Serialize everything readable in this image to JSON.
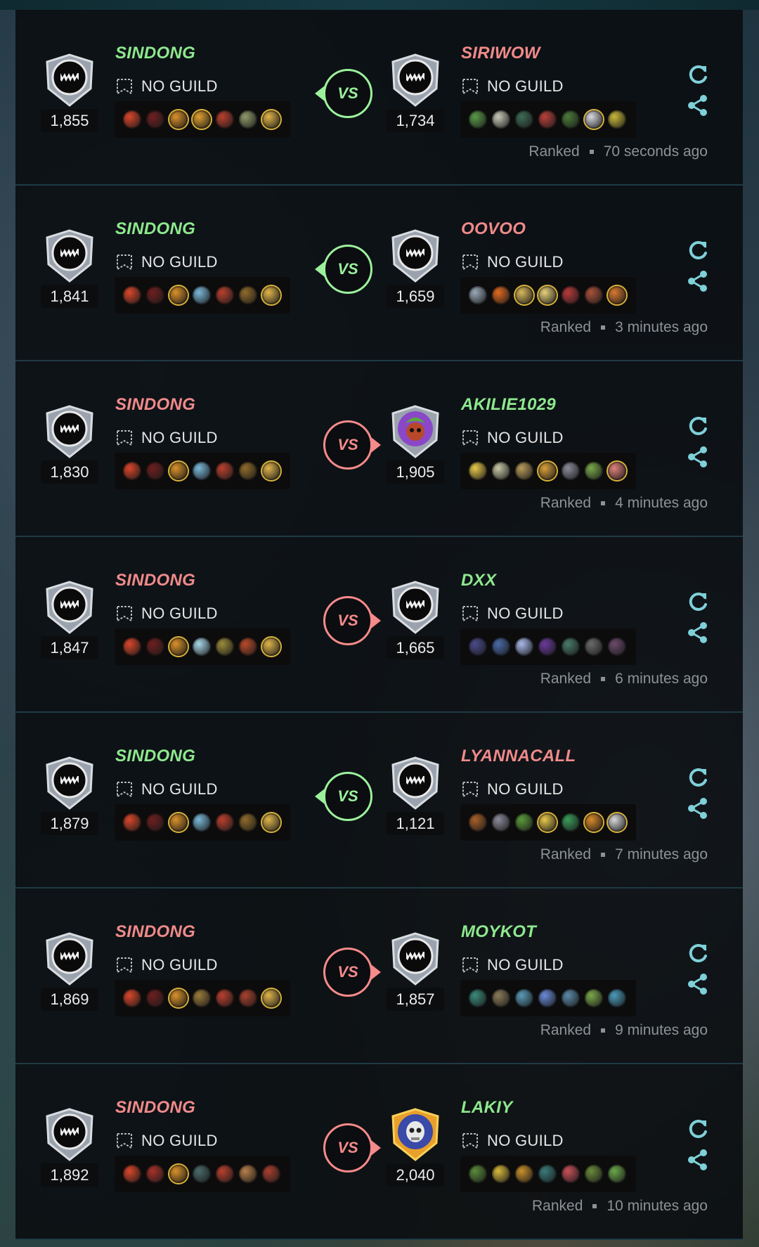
{
  "colors": {
    "win": "#8ee88e",
    "lose": "#f08a8a",
    "accent": "#7fd0d8"
  },
  "matches": [
    {
      "vs_label": "VS",
      "vs_result": "win",
      "left": {
        "name": "SINDONG",
        "result": "win",
        "guild": "NO GUILD",
        "rating": "1,855",
        "badge": "monster-badge-icon",
        "units": [
          "#d8462a",
          "#6e1f1f",
          "#d9912a",
          "#e0a030",
          "#b8402e",
          "#8f9a6a",
          "#e0b44a"
        ]
      },
      "right": {
        "name": "SIRIWOW",
        "result": "lose",
        "guild": "NO GUILD",
        "rating": "1,734",
        "badge": "monster-badge-icon",
        "units": [
          "#5a9a4a",
          "#c8c8b8",
          "#3d6a55",
          "#b8403a",
          "#4a7a3a",
          "#d8d8e0",
          "#c8b83a"
        ]
      },
      "mode": "Ranked",
      "time": "70 seconds ago"
    },
    {
      "vs_label": "VS",
      "vs_result": "win",
      "left": {
        "name": "SINDONG",
        "result": "win",
        "guild": "NO GUILD",
        "rating": "1,841",
        "badge": "monster-badge-icon",
        "units": [
          "#d8462a",
          "#6e1f1f",
          "#d9912a",
          "#7ab8d8",
          "#b8402e",
          "#8f6a2a",
          "#e0b44a"
        ]
      },
      "right": {
        "name": "OOVOO",
        "result": "lose",
        "guild": "NO GUILD",
        "rating": "1,659",
        "badge": "monster-badge-icon",
        "units": [
          "#9aa8b8",
          "#e06a20",
          "#d8b85a",
          "#e8d07a",
          "#b83a3a",
          "#a8503a",
          "#d87a30"
        ]
      },
      "mode": "Ranked",
      "time": "3 minutes ago"
    },
    {
      "vs_label": "VS",
      "vs_result": "lose",
      "left": {
        "name": "SINDONG",
        "result": "lose",
        "guild": "NO GUILD",
        "rating": "1,830",
        "badge": "monster-badge-icon",
        "units": [
          "#d8462a",
          "#6e1f1f",
          "#d9912a",
          "#7ab8d8",
          "#b8402e",
          "#8f6a2a",
          "#e0b44a"
        ]
      },
      "right": {
        "name": "AKILIE1029",
        "result": "win",
        "guild": "NO GUILD",
        "rating": "1,905",
        "badge": "avatar-badge-icon",
        "units": [
          "#e8c84a",
          "#c8c8a8",
          "#b89a5a",
          "#d8a03a",
          "#8a8a9a",
          "#7aa84a",
          "#e0807a"
        ]
      },
      "mode": "Ranked",
      "time": "4 minutes ago"
    },
    {
      "vs_label": "VS",
      "vs_result": "lose",
      "left": {
        "name": "SINDONG",
        "result": "lose",
        "guild": "NO GUILD",
        "rating": "1,847",
        "badge": "monster-badge-icon",
        "units": [
          "#d8462a",
          "#6e1f1f",
          "#d9912a",
          "#a8d8e8",
          "#9a8a3a",
          "#b84a2a",
          "#e0b44a"
        ]
      },
      "right": {
        "name": "DXX",
        "result": "win",
        "guild": "NO GUILD",
        "rating": "1,665",
        "badge": "monster-badge-icon",
        "units": [
          "#4a4a8a",
          "#4a6aa8",
          "#a8b8e8",
          "#6a3a9a",
          "#4a7a6a",
          "#6a6a6a",
          "#6a4a6a"
        ]
      },
      "mode": "Ranked",
      "time": "6 minutes ago"
    },
    {
      "vs_label": "VS",
      "vs_result": "win",
      "left": {
        "name": "SINDONG",
        "result": "win",
        "guild": "NO GUILD",
        "rating": "1,879",
        "badge": "monster-badge-icon",
        "units": [
          "#d8462a",
          "#6e1f1f",
          "#d9912a",
          "#7ab8d8",
          "#b8402e",
          "#8f6a2a",
          "#e0b44a"
        ]
      },
      "right": {
        "name": "LYANNACALL",
        "result": "lose",
        "guild": "NO GUILD",
        "rating": "1,121",
        "badge": "monster-badge-icon",
        "units": [
          "#a8602a",
          "#8a8a9a",
          "#5a9a3a",
          "#e8c84a",
          "#3a9a5a",
          "#d88a2a",
          "#d8d8d8"
        ]
      },
      "mode": "Ranked",
      "time": "7 minutes ago"
    },
    {
      "vs_label": "VS",
      "vs_result": "lose",
      "left": {
        "name": "SINDONG",
        "result": "lose",
        "guild": "NO GUILD",
        "rating": "1,869",
        "badge": "monster-badge-icon",
        "units": [
          "#d8462a",
          "#6e1f1f",
          "#d9912a",
          "#9a7a3a",
          "#b8402e",
          "#a8402e",
          "#e0b44a"
        ]
      },
      "right": {
        "name": "MOYKOT",
        "result": "win",
        "guild": "NO GUILD",
        "rating": "1,857",
        "badge": "monster-badge-icon",
        "units": [
          "#3a8a7a",
          "#8a7a5a",
          "#5a9ab8",
          "#6a8ad8",
          "#5a8aa8",
          "#7aa84a",
          "#4a9ab8"
        ]
      },
      "mode": "Ranked",
      "time": "9 minutes ago"
    },
    {
      "vs_label": "VS",
      "vs_result": "lose",
      "left": {
        "name": "SINDONG",
        "result": "lose",
        "guild": "NO GUILD",
        "rating": "1,892",
        "badge": "monster-badge-icon",
        "units": [
          "#d8462a",
          "#a8302a",
          "#d9912a",
          "#4a6a6a",
          "#b8402e",
          "#b8804a",
          "#a8402e"
        ]
      },
      "right": {
        "name": "LAKIY",
        "result": "win",
        "guild": "NO GUILD",
        "rating": "2,040",
        "badge": "skull-avatar-badge-icon",
        "units": [
          "#5a8a3a",
          "#d8b83a",
          "#c8902a",
          "#3a7a7a",
          "#c8505a",
          "#6a8a3a",
          "#6aa84a"
        ]
      },
      "mode": "Ranked",
      "time": "10 minutes ago"
    }
  ]
}
